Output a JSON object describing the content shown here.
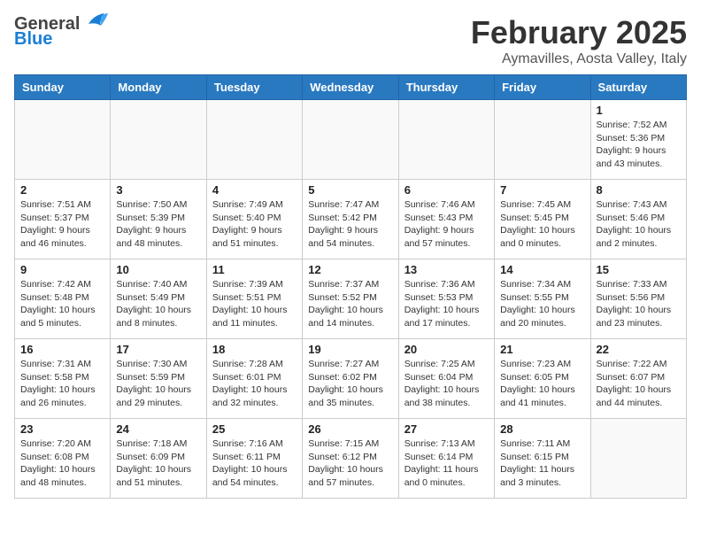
{
  "header": {
    "logo_general": "General",
    "logo_blue": "Blue",
    "month": "February 2025",
    "location": "Aymavilles, Aosta Valley, Italy"
  },
  "weekdays": [
    "Sunday",
    "Monday",
    "Tuesday",
    "Wednesday",
    "Thursday",
    "Friday",
    "Saturday"
  ],
  "weeks": [
    [
      {
        "day": "",
        "info": ""
      },
      {
        "day": "",
        "info": ""
      },
      {
        "day": "",
        "info": ""
      },
      {
        "day": "",
        "info": ""
      },
      {
        "day": "",
        "info": ""
      },
      {
        "day": "",
        "info": ""
      },
      {
        "day": "1",
        "info": "Sunrise: 7:52 AM\nSunset: 5:36 PM\nDaylight: 9 hours and 43 minutes."
      }
    ],
    [
      {
        "day": "2",
        "info": "Sunrise: 7:51 AM\nSunset: 5:37 PM\nDaylight: 9 hours and 46 minutes."
      },
      {
        "day": "3",
        "info": "Sunrise: 7:50 AM\nSunset: 5:39 PM\nDaylight: 9 hours and 48 minutes."
      },
      {
        "day": "4",
        "info": "Sunrise: 7:49 AM\nSunset: 5:40 PM\nDaylight: 9 hours and 51 minutes."
      },
      {
        "day": "5",
        "info": "Sunrise: 7:47 AM\nSunset: 5:42 PM\nDaylight: 9 hours and 54 minutes."
      },
      {
        "day": "6",
        "info": "Sunrise: 7:46 AM\nSunset: 5:43 PM\nDaylight: 9 hours and 57 minutes."
      },
      {
        "day": "7",
        "info": "Sunrise: 7:45 AM\nSunset: 5:45 PM\nDaylight: 10 hours and 0 minutes."
      },
      {
        "day": "8",
        "info": "Sunrise: 7:43 AM\nSunset: 5:46 PM\nDaylight: 10 hours and 2 minutes."
      }
    ],
    [
      {
        "day": "9",
        "info": "Sunrise: 7:42 AM\nSunset: 5:48 PM\nDaylight: 10 hours and 5 minutes."
      },
      {
        "day": "10",
        "info": "Sunrise: 7:40 AM\nSunset: 5:49 PM\nDaylight: 10 hours and 8 minutes."
      },
      {
        "day": "11",
        "info": "Sunrise: 7:39 AM\nSunset: 5:51 PM\nDaylight: 10 hours and 11 minutes."
      },
      {
        "day": "12",
        "info": "Sunrise: 7:37 AM\nSunset: 5:52 PM\nDaylight: 10 hours and 14 minutes."
      },
      {
        "day": "13",
        "info": "Sunrise: 7:36 AM\nSunset: 5:53 PM\nDaylight: 10 hours and 17 minutes."
      },
      {
        "day": "14",
        "info": "Sunrise: 7:34 AM\nSunset: 5:55 PM\nDaylight: 10 hours and 20 minutes."
      },
      {
        "day": "15",
        "info": "Sunrise: 7:33 AM\nSunset: 5:56 PM\nDaylight: 10 hours and 23 minutes."
      }
    ],
    [
      {
        "day": "16",
        "info": "Sunrise: 7:31 AM\nSunset: 5:58 PM\nDaylight: 10 hours and 26 minutes."
      },
      {
        "day": "17",
        "info": "Sunrise: 7:30 AM\nSunset: 5:59 PM\nDaylight: 10 hours and 29 minutes."
      },
      {
        "day": "18",
        "info": "Sunrise: 7:28 AM\nSunset: 6:01 PM\nDaylight: 10 hours and 32 minutes."
      },
      {
        "day": "19",
        "info": "Sunrise: 7:27 AM\nSunset: 6:02 PM\nDaylight: 10 hours and 35 minutes."
      },
      {
        "day": "20",
        "info": "Sunrise: 7:25 AM\nSunset: 6:04 PM\nDaylight: 10 hours and 38 minutes."
      },
      {
        "day": "21",
        "info": "Sunrise: 7:23 AM\nSunset: 6:05 PM\nDaylight: 10 hours and 41 minutes."
      },
      {
        "day": "22",
        "info": "Sunrise: 7:22 AM\nSunset: 6:07 PM\nDaylight: 10 hours and 44 minutes."
      }
    ],
    [
      {
        "day": "23",
        "info": "Sunrise: 7:20 AM\nSunset: 6:08 PM\nDaylight: 10 hours and 48 minutes."
      },
      {
        "day": "24",
        "info": "Sunrise: 7:18 AM\nSunset: 6:09 PM\nDaylight: 10 hours and 51 minutes."
      },
      {
        "day": "25",
        "info": "Sunrise: 7:16 AM\nSunset: 6:11 PM\nDaylight: 10 hours and 54 minutes."
      },
      {
        "day": "26",
        "info": "Sunrise: 7:15 AM\nSunset: 6:12 PM\nDaylight: 10 hours and 57 minutes."
      },
      {
        "day": "27",
        "info": "Sunrise: 7:13 AM\nSunset: 6:14 PM\nDaylight: 11 hours and 0 minutes."
      },
      {
        "day": "28",
        "info": "Sunrise: 7:11 AM\nSunset: 6:15 PM\nDaylight: 11 hours and 3 minutes."
      },
      {
        "day": "",
        "info": ""
      }
    ]
  ]
}
